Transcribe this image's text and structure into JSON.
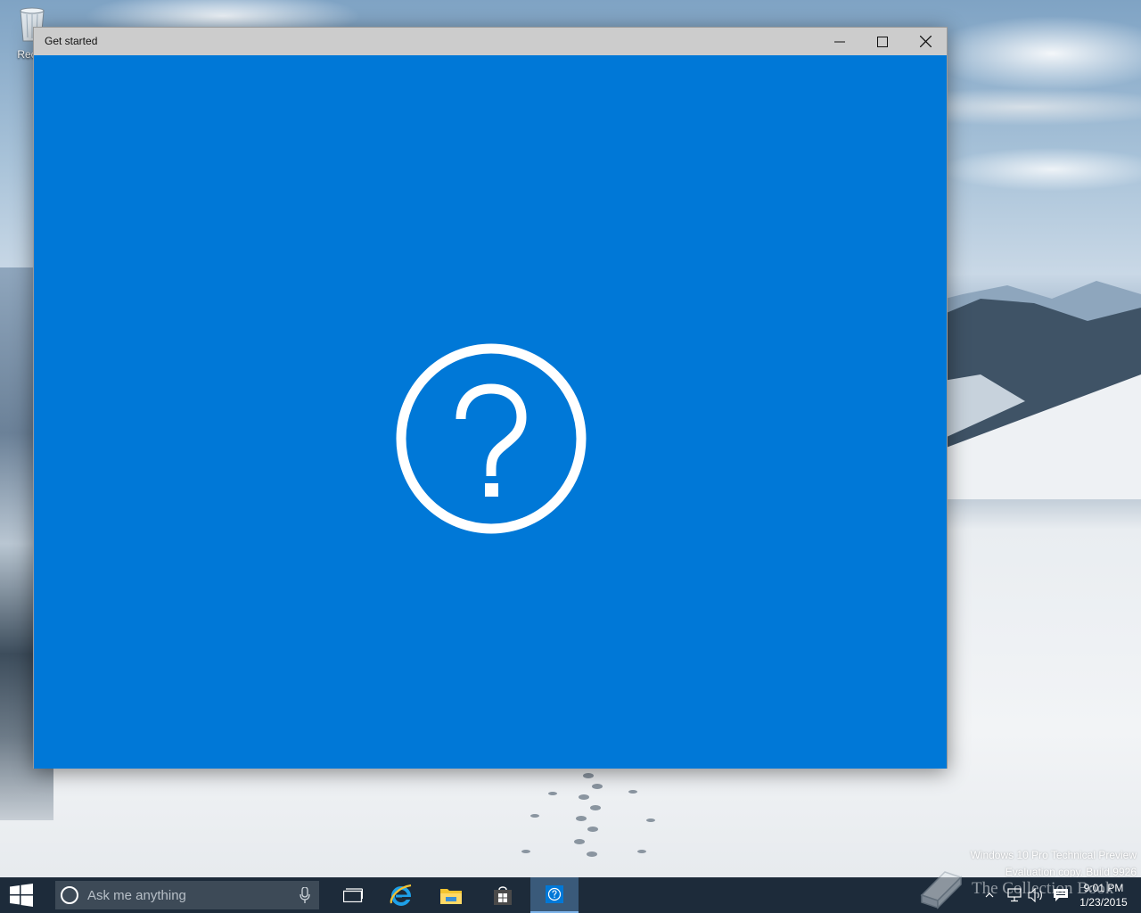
{
  "desktop": {
    "recycle_bin_label": "Recyc",
    "watermark_line1": "Windows 10 Pro Technical Preview",
    "watermark_line2": "Evaluation copy. Build 9926",
    "overlay_logo_text": "The Collection Book"
  },
  "window": {
    "title": "Get started",
    "content_icon": "help-circle-icon",
    "accent_color": "#0078d7",
    "titlebar_color": "#cccccc"
  },
  "taskbar": {
    "search_placeholder": "Ask me anything",
    "apps": [
      "task-view-icon",
      "internet-explorer-icon",
      "file-explorer-icon",
      "store-icon",
      "get-started-icon"
    ],
    "clock_time": "9:01 PM",
    "clock_date": "1/23/2015"
  }
}
